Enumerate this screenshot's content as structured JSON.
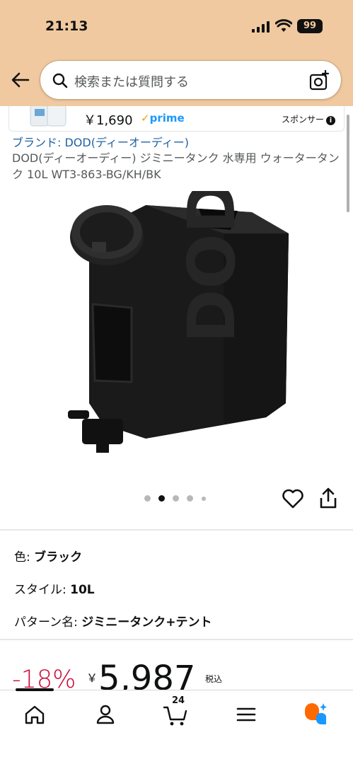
{
  "status": {
    "time": "21:13",
    "battery": "99"
  },
  "search": {
    "placeholder": "検索または質問する"
  },
  "sponsored": {
    "price": "￥1,690",
    "prime_check": "✓",
    "prime_label": "prime",
    "label": "スポンサー",
    "info_icon": "i"
  },
  "product": {
    "brand": "ブランド: DOD(ディーオーディー)",
    "title": "DOD(ディーオーディー) ジミニータンク 水専用 ウォータータンク 10L WT3-863-BG/KH/BK",
    "image_count": 5,
    "active_image": 2
  },
  "options": [
    {
      "label": "色: ",
      "value": "ブラック"
    },
    {
      "label": "スタイル: ",
      "value": "10L"
    },
    {
      "label": "パターン名: ",
      "value": "ジミニータンク+テント"
    }
  ],
  "price": {
    "discount": "-18%",
    "currency": "￥",
    "amount": "5,987",
    "tax": "税込"
  },
  "bottom_nav": {
    "cart_count": "24",
    "items": [
      "home-icon",
      "account-icon",
      "cart-icon",
      "menu-icon",
      "rufus-icon"
    ]
  },
  "colors": {
    "header_bg": "#f1c9a0",
    "link": "#2162a1",
    "discount": "#cc0c39",
    "prime": "#1a98ff"
  }
}
